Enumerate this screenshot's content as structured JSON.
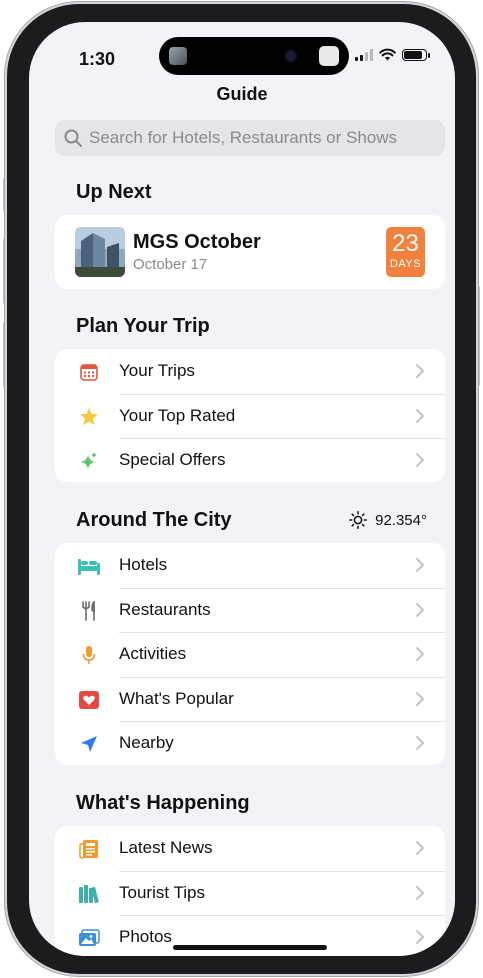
{
  "status_bar": {
    "time": "1:30"
  },
  "nav": {
    "title": "Guide"
  },
  "search": {
    "placeholder": "Search for Hotels, Restaurants or Shows"
  },
  "up_next": {
    "heading": "Up Next",
    "event_title": "MGS October",
    "event_date": "October 17",
    "countdown_number": "23",
    "countdown_unit": "DAYS"
  },
  "plan_trip": {
    "heading": "Plan Your Trip",
    "items": [
      {
        "label": "Your Trips",
        "icon": "calendar-icon"
      },
      {
        "label": "Your Top Rated",
        "icon": "star-icon"
      },
      {
        "label": "Special Offers",
        "icon": "sparkles-icon"
      }
    ]
  },
  "around_city": {
    "heading": "Around The City",
    "weather_value": "92.354°",
    "items": [
      {
        "label": "Hotels",
        "icon": "bed-icon"
      },
      {
        "label": "Restaurants",
        "icon": "fork-knife-icon"
      },
      {
        "label": "Activities",
        "icon": "microphone-icon"
      },
      {
        "label": "What's Popular",
        "icon": "heart-icon"
      },
      {
        "label": "Nearby",
        "icon": "location-arrow-icon"
      }
    ]
  },
  "happening": {
    "heading": "What's Happening",
    "items": [
      {
        "label": "Latest News",
        "icon": "newspaper-icon"
      },
      {
        "label": "Tourist Tips",
        "icon": "books-icon"
      },
      {
        "label": "Photos",
        "icon": "photos-icon"
      }
    ]
  },
  "colors": {
    "background": "#f2f2f7",
    "card": "#ffffff",
    "countdown": "#f0813f",
    "calendar": "#e2553f",
    "star": "#f6c744",
    "sparkles": "#5ec46e",
    "bed": "#3fbfb1",
    "mic": "#f09a2e",
    "heart": "#e24b3f",
    "location": "#2f7cf6",
    "news": "#f09a2e",
    "books": "#3fb0a8",
    "photos": "#3a8fd8"
  }
}
